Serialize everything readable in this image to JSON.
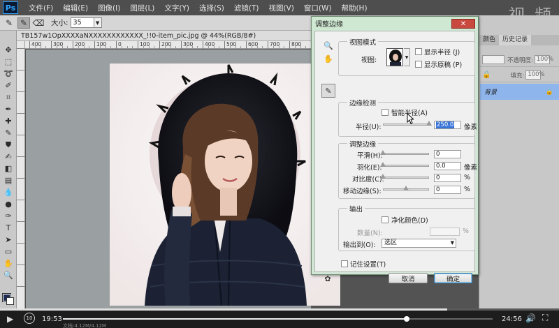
{
  "app": {
    "logo_text": "Ps",
    "menu": [
      "文件(F)",
      "编辑(E)",
      "图像(I)",
      "图层(L)",
      "文字(Y)",
      "选择(S)",
      "滤镜(T)",
      "视图(V)",
      "窗口(W)",
      "帮助(H)"
    ],
    "watermark": "视 频"
  },
  "options_bar": {
    "size_label": "大小:",
    "size_value": "35"
  },
  "document": {
    "tab_title": "TB157w1OpXXXXaNXXXXXXXXXXXX_!!0-item_pic.jpg @ 44%(RGB/8#)",
    "ruler_marks": [
      "400",
      "300",
      "200",
      "100",
      "0",
      "100",
      "200",
      "300",
      "400",
      "500",
      "600",
      "700",
      "800",
      "900"
    ]
  },
  "right_panel": {
    "tabs": [
      "颜色",
      "历史记录"
    ],
    "opacity_label": "不透明度:",
    "opacity_value": "100%",
    "fill_label": "填充:",
    "fill_value": "100%",
    "layer_name": "背景"
  },
  "dialog": {
    "title": "调整边缘",
    "close_label": "✕",
    "view_mode": {
      "group_title": "视图模式",
      "view_label": "视图:",
      "show_radius": "显示半径 (J)",
      "show_original": "显示原稿 (P)"
    },
    "edge_detection": {
      "group_title": "边缘检测",
      "smart_radius": "智能半径(A)",
      "radius_label": "半径(U):",
      "radius_value": "250.0",
      "radius_unit": "像素",
      "radius_fraction": 1.0
    },
    "adjust_edge": {
      "group_title": "调整边缘",
      "rows": [
        {
          "label": "平滑(H):",
          "value": "0",
          "unit": "",
          "fraction": 0
        },
        {
          "label": "羽化(E):",
          "value": "0.0",
          "unit": "像素",
          "fraction": 0
        },
        {
          "label": "对比度(C):",
          "value": "0",
          "unit": "%",
          "fraction": 0
        },
        {
          "label": "移动边缘(S):",
          "value": "0",
          "unit": "%",
          "fraction": 0.5
        }
      ]
    },
    "output": {
      "group_title": "输出",
      "decontaminate": "净化颜色(D)",
      "amount_label": "数量(N):",
      "amount_unit": "%",
      "output_to_label": "输出到(O):",
      "output_to_value": "选区"
    },
    "remember": "记住设置(T)",
    "cancel": "取消",
    "ok": "确定"
  },
  "player": {
    "current_time": "19:53",
    "total_time": "24:56",
    "rewind_label": "10",
    "progress_fraction": 0.8,
    "status_text": "文档:4.12M/4.12M"
  },
  "colors": {
    "accent_selection": "#3874d8",
    "layer_highlight": "#8fb6ec",
    "dialog_frame": "#d2e5d6",
    "close_button": "#c9493f"
  }
}
